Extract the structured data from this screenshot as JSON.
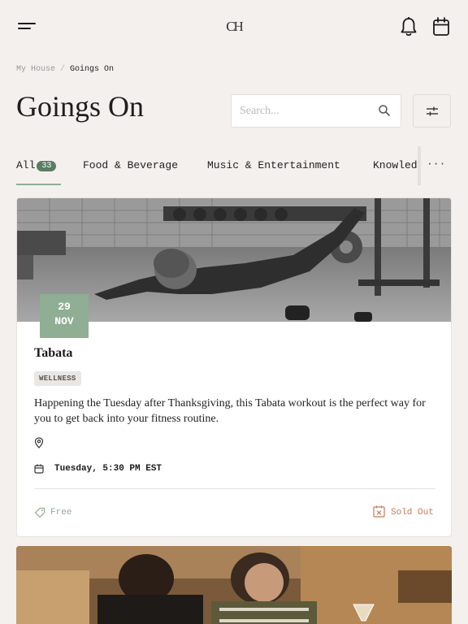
{
  "header": {
    "logo_text": "CH",
    "menu_icon": "hamburger-menu-icon",
    "notifications_icon": "bell-icon",
    "calendar_icon": "calendar-icon"
  },
  "breadcrumb": {
    "items": [
      "My House",
      "Goings On"
    ],
    "separator": "/"
  },
  "page": {
    "title": "Goings On"
  },
  "search": {
    "placeholder": "Search...",
    "value": ""
  },
  "tabs": {
    "items": [
      {
        "label": "All",
        "count": "33",
        "active": true
      },
      {
        "label": "Food & Beverage"
      },
      {
        "label": "Music & Entertainment"
      },
      {
        "label": "Knowledge"
      }
    ],
    "more_label": "···"
  },
  "events": [
    {
      "day": "29",
      "month": "NOV",
      "title": "Tabata",
      "tag": "WELLNESS",
      "description": "Happening the Tuesday after Thanksgiving, this Tabata workout is the perfect way for you to get back into your fitness routine.",
      "time": "Tuesday, 5:30 PM EST",
      "price": "Free",
      "status": "Sold Out"
    }
  ],
  "colors": {
    "background": "#f4f0ed",
    "accent_green": "#8fae94",
    "badge_dark_green": "#5a7d63",
    "sold_out": "#c87959"
  }
}
